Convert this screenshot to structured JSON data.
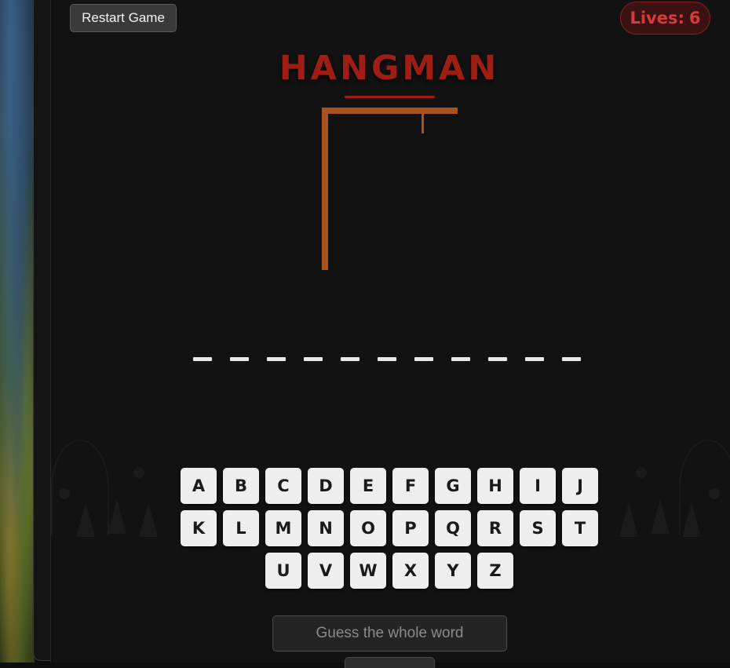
{
  "header": {
    "restart_label": "Restart Game",
    "lives_label": "Lives:",
    "lives_value": "6"
  },
  "title": "HANGMAN",
  "word": {
    "slots": [
      "",
      "",
      "",
      "",
      "",
      "",
      "",
      "",
      "",
      "",
      ""
    ]
  },
  "keyboard": {
    "rows": [
      [
        "A",
        "B",
        "C",
        "D",
        "E",
        "F",
        "G",
        "H",
        "I",
        "J"
      ],
      [
        "K",
        "L",
        "M",
        "N",
        "O",
        "P",
        "Q",
        "R",
        "S",
        "T"
      ],
      [
        "U",
        "V",
        "W",
        "X",
        "Y",
        "Z"
      ]
    ]
  },
  "guess": {
    "placeholder": "Guess the whole word",
    "value": ""
  },
  "colors": {
    "title": "#9e1e16",
    "lives_text": "#d83a3a",
    "gallows": "#a8521e",
    "key_bg": "#eeeeee"
  }
}
